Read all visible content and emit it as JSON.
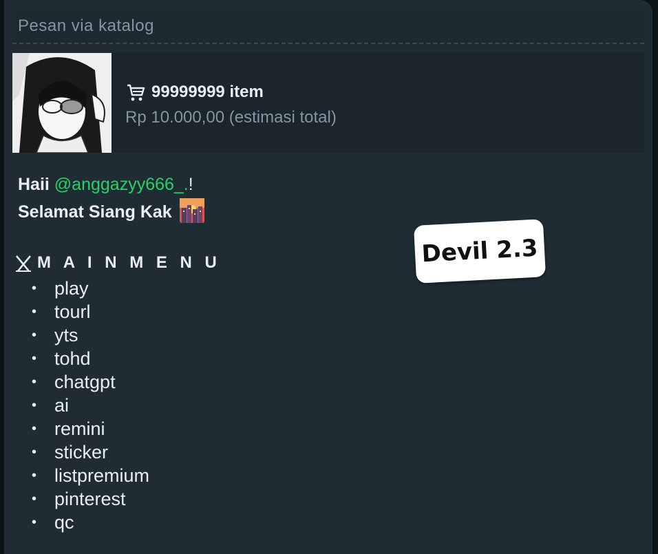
{
  "catalog": {
    "title": "Pesan via katalog",
    "item_count": "99999999 item",
    "price": "Rp 10.000,00 (estimasi total)",
    "icon": "cart-icon"
  },
  "message": {
    "greeting_prefix": "Haii ",
    "mention": "@anggazyy666_.",
    "greeting_suffix": "!",
    "salutation": "Selamat Siang Kak",
    "salutation_icon": "sunset-city-icon"
  },
  "menu": {
    "title": "M A I N M E N U",
    "items": [
      "play",
      "tourl",
      "yts",
      "tohd",
      "chatgpt",
      "ai",
      "remini",
      "sticker",
      "listpremium",
      "pinterest",
      "qc"
    ],
    "bullet": "•"
  },
  "sticker": {
    "text": "Devil 2.3"
  },
  "colors": {
    "bubble": "#1f2c34",
    "mention": "#25d366",
    "text": "#e9edef",
    "muted": "#8696a0"
  }
}
